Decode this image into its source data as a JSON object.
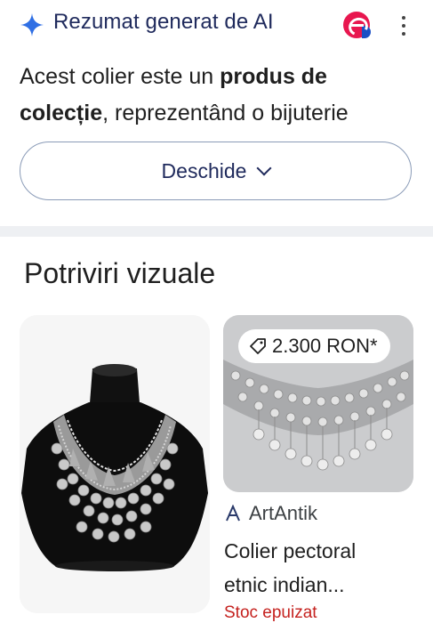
{
  "ai_overview": {
    "title": "Rezumat generat de AI",
    "summary_plain_1": "Acest colier este un ",
    "summary_bold_1": "produs de colecție",
    "summary_plain_2": ", reprezentând o bijuterie",
    "open_label": "Deschide",
    "icons": {
      "header": "sparkle-icon",
      "chevron": "chevron-down-icon",
      "menu": "more-vert-icon"
    }
  },
  "visual_matches": {
    "title": "Potriviri vizuale",
    "items": [
      {
        "image": "necklace-on-black-bust"
      },
      {
        "image": "silver-coin-necklace-grey",
        "price": "2.300 RON*",
        "source": "ArtAntik",
        "title_line_1": "Colier pectoral",
        "title_line_2": "etnic indian...",
        "stock": "Stoc epuizat"
      }
    ]
  },
  "colors": {
    "accent": "#1f2a5c",
    "out_of_stock": "#c5221f",
    "brand_e": "#e8174f"
  }
}
